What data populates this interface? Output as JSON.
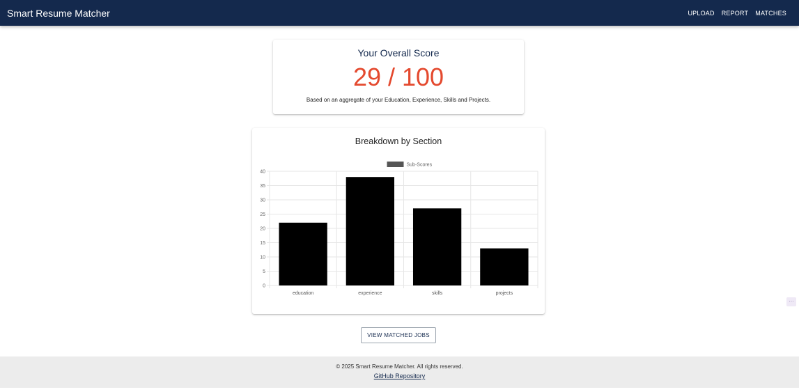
{
  "header": {
    "title": "Smart Resume Matcher",
    "nav": [
      "UPLOAD",
      "REPORT",
      "MATCHES"
    ]
  },
  "score": {
    "title": "Your Overall Score",
    "value": "29 / 100",
    "description": "Based on an aggregate of your Education, Experience, Skills and Projects."
  },
  "breakdown": {
    "title": "Breakdown by Section"
  },
  "chart_data": {
    "type": "bar",
    "categories": [
      "education",
      "experience",
      "skills",
      "projects"
    ],
    "series": [
      {
        "name": "Sub-Scores",
        "values": [
          22,
          38,
          27,
          13
        ]
      }
    ],
    "ylim": [
      0,
      40
    ],
    "yticks": [
      0,
      5,
      10,
      15,
      20,
      25,
      30,
      35,
      40
    ],
    "legend": "top",
    "grid": true,
    "bar_color": "#000000",
    "legend_swatch_color": "#555555"
  },
  "actions": {
    "view_jobs": "VIEW MATCHED JOBS"
  },
  "footer": {
    "copyright": "© 2025 Smart Resume Matcher. All rights reserved.",
    "link": "GitHub Repository"
  },
  "colors": {
    "appbar": "#14294d",
    "score": "#e4492e"
  },
  "icons": {
    "extension": "extension-icon"
  }
}
